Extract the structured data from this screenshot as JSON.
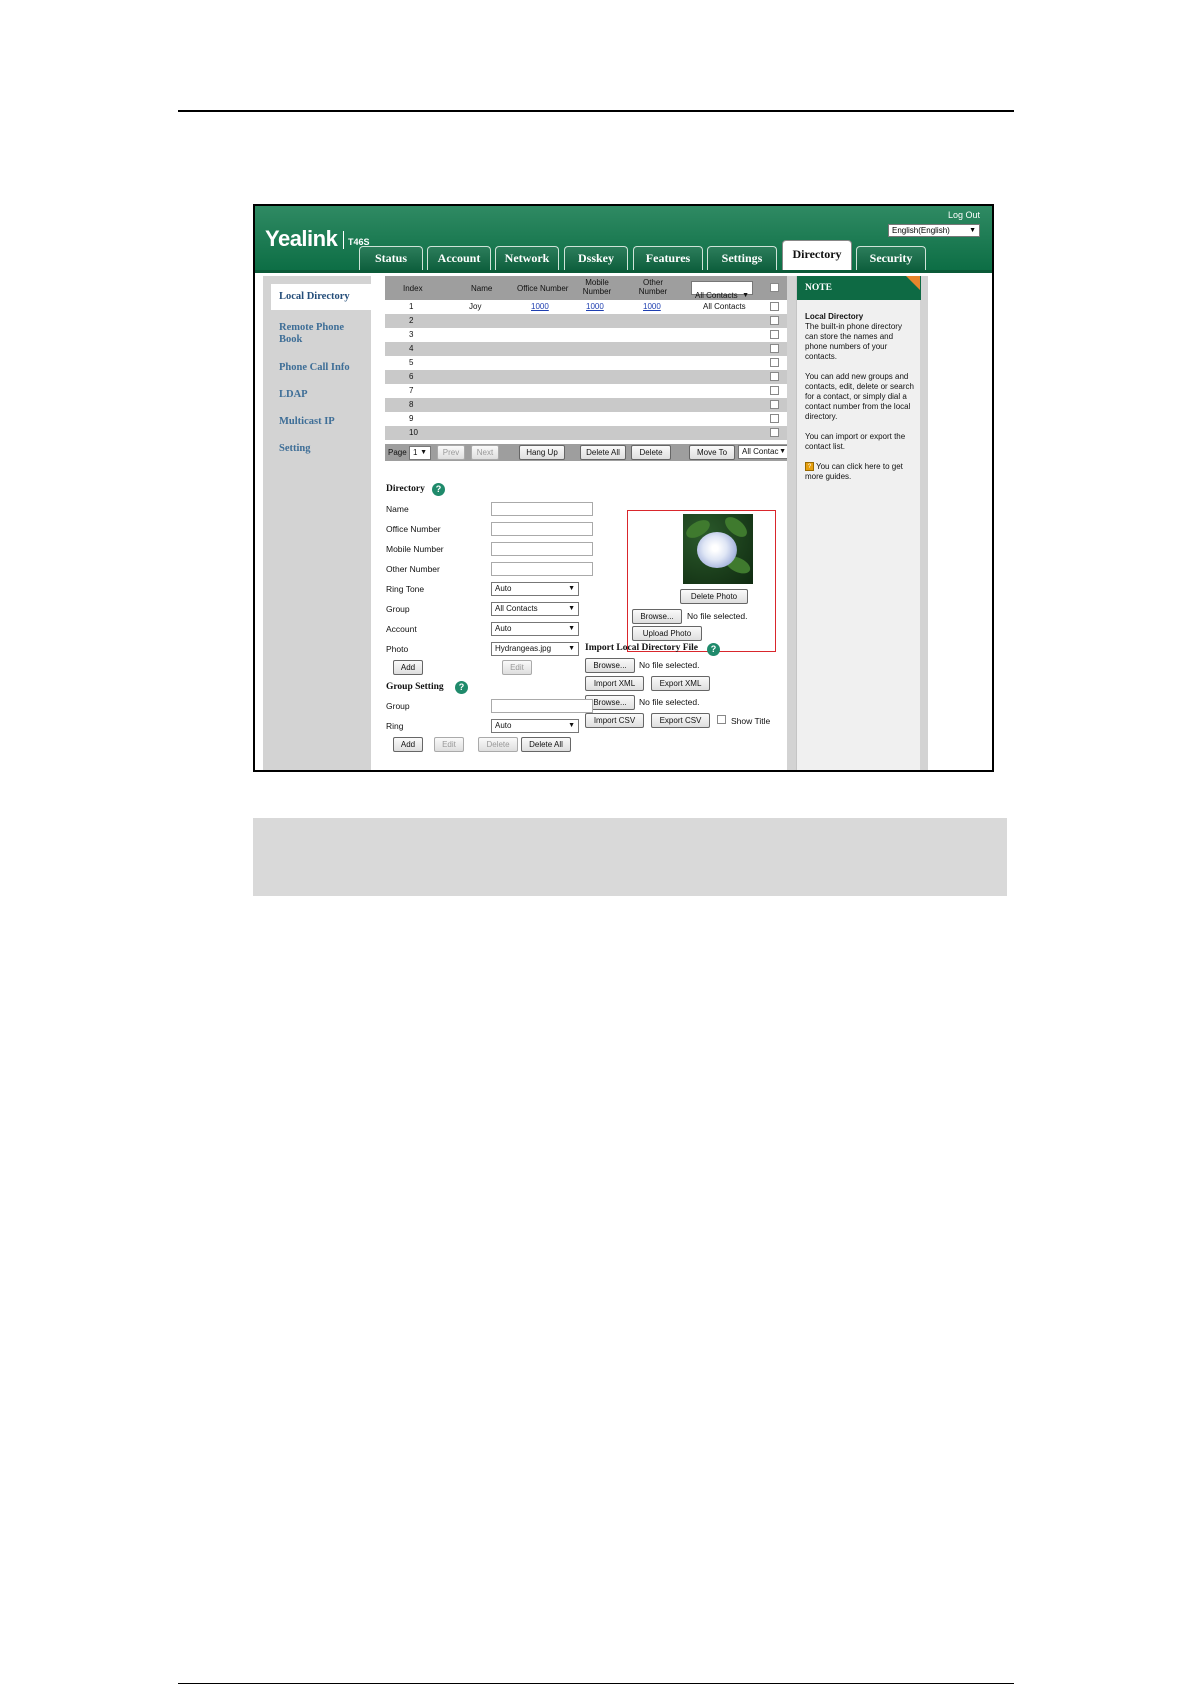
{
  "header": {
    "logo": "Yealink",
    "model": "T46S",
    "logout": "Log Out",
    "language": "English(English)"
  },
  "tabs": [
    "Status",
    "Account",
    "Network",
    "Dsskey",
    "Features",
    "Settings",
    "Directory",
    "Security"
  ],
  "active_tab": "Directory",
  "sidebar": {
    "items": [
      "Local Directory",
      "Remote Phone Book",
      "Phone Call Info",
      "LDAP",
      "Multicast IP",
      "Setting"
    ]
  },
  "table": {
    "headers": {
      "index": "Index",
      "name": "Name",
      "office": "Office Number",
      "mobile": "Mobile Number",
      "other": "Other Number",
      "group_filter": "All Contacts"
    },
    "rows": [
      {
        "index": "1",
        "name": "Joy",
        "office": "1000",
        "mobile": "1000",
        "other": "1000",
        "group": "All Contacts"
      },
      {
        "index": "2"
      },
      {
        "index": "3"
      },
      {
        "index": "4"
      },
      {
        "index": "5"
      },
      {
        "index": "6"
      },
      {
        "index": "7"
      },
      {
        "index": "8"
      },
      {
        "index": "9"
      },
      {
        "index": "10"
      }
    ]
  },
  "pager": {
    "page_label": "Page",
    "page_value": "1",
    "prev": "Prev",
    "next": "Next",
    "hang_up": "Hang Up",
    "delete_all": "Delete All",
    "delete": "Delete",
    "move_to": "Move To",
    "move_target": "All Contac"
  },
  "directory_form": {
    "title": "Directory",
    "name": "Name",
    "office": "Office Number",
    "mobile": "Mobile Number",
    "other": "Other Number",
    "ring_tone": "Ring Tone",
    "ring_tone_value": "Auto",
    "group": "Group",
    "group_value": "All Contacts",
    "account": "Account",
    "account_value": "Auto",
    "photo": "Photo",
    "photo_value": "Hydrangeas.jpg",
    "add": "Add",
    "edit": "Edit"
  },
  "photo_panel": {
    "delete_photo": "Delete Photo",
    "browse": "Browse...",
    "no_file": "No file selected.",
    "upload_photo": "Upload Photo"
  },
  "import_section": {
    "title": "Import Local Directory File",
    "browse": "Browse...",
    "no_file": "No file selected.",
    "import_xml": "Import XML",
    "export_xml": "Export XML",
    "browse2": "Browse...",
    "no_file2": "No file selected.",
    "import_csv": "Import CSV",
    "export_csv": "Export CSV",
    "show_title": "Show Title"
  },
  "group_setting": {
    "title": "Group Setting",
    "group": "Group",
    "ring": "Ring",
    "ring_value": "Auto",
    "add": "Add",
    "edit": "Edit",
    "delete": "Delete",
    "delete_all": "Delete All"
  },
  "note": {
    "title": "NOTE",
    "heading": "Local Directory",
    "p1": "The built-in phone directory can store the names and phone numbers of your contacts.",
    "p2": "You can add new groups and contacts, edit, delete or search for a contact, or simply dial a contact number from the local directory.",
    "p3": "You can import or export the contact list.",
    "p4": "You can click here to get more guides."
  },
  "colors": {
    "header_green": "#0d6e45",
    "link_blue": "#1f3fb0",
    "highlight_red": "#d9262c",
    "note_orange": "#e8852c"
  }
}
